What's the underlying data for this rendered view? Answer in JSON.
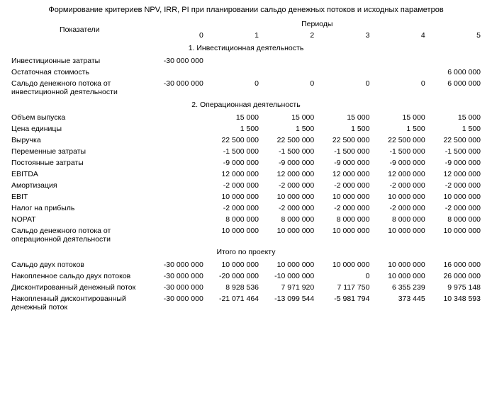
{
  "title": "Формирование критериев NPV, IRR, PI при планировании сальдо денежных потоков и исходных параметров",
  "header": {
    "indicator": "Показатели",
    "periods": "Периоды",
    "cols": [
      "0",
      "1",
      "2",
      "3",
      "4",
      "5"
    ]
  },
  "section1": {
    "heading": "1. Инвестиционная деятельность",
    "rows": [
      {
        "label": "Инвестиционные затраты",
        "v": [
          "-30 000 000",
          "",
          "",
          "",
          "",
          ""
        ]
      },
      {
        "label": "Остаточная стоимость",
        "v": [
          "",
          "",
          "",
          "",
          "",
          "6 000 000"
        ]
      },
      {
        "label": "Сальдо денежного потока от инвестиционной деятельности",
        "v": [
          "-30 000 000",
          "0",
          "0",
          "0",
          "0",
          "6 000 000"
        ]
      }
    ]
  },
  "section2": {
    "heading": "2. Операционная деятельность",
    "rows": [
      {
        "label": "Объем выпуска",
        "v": [
          "",
          "15 000",
          "15 000",
          "15 000",
          "15 000",
          "15 000"
        ]
      },
      {
        "label": "Цена единицы",
        "v": [
          "",
          "1 500",
          "1 500",
          "1 500",
          "1 500",
          "1 500"
        ]
      },
      {
        "label": "Выручка",
        "v": [
          "",
          "22 500 000",
          "22 500 000",
          "22 500 000",
          "22 500 000",
          "22 500 000"
        ]
      },
      {
        "label": "Переменные затраты",
        "v": [
          "",
          "-1 500 000",
          "-1 500 000",
          "-1 500 000",
          "-1 500 000",
          "-1 500 000"
        ]
      },
      {
        "label": "Постоянные затраты",
        "v": [
          "",
          "-9 000 000",
          "-9 000 000",
          "-9 000 000",
          "-9 000 000",
          "-9 000 000"
        ]
      },
      {
        "label": "EBITDA",
        "v": [
          "",
          "12 000 000",
          "12 000 000",
          "12 000 000",
          "12 000 000",
          "12 000 000"
        ]
      },
      {
        "label": "Амортизация",
        "v": [
          "",
          "-2 000 000",
          "-2 000 000",
          "-2 000 000",
          "-2 000 000",
          "-2 000 000"
        ]
      },
      {
        "label": "EBIT",
        "v": [
          "",
          "10 000 000",
          "10 000 000",
          "10 000 000",
          "10 000 000",
          "10 000 000"
        ]
      },
      {
        "label": "Налог на прибыль",
        "v": [
          "",
          "-2 000 000",
          "-2 000 000",
          "-2 000 000",
          "-2 000 000",
          "-2 000 000"
        ]
      },
      {
        "label": "NOPAT",
        "v": [
          "",
          "8 000 000",
          "8 000 000",
          "8 000 000",
          "8 000 000",
          "8 000 000"
        ]
      },
      {
        "label": "Сальдо денежного потока от операционной деятельности",
        "v": [
          "",
          "10 000 000",
          "10 000 000",
          "10 000 000",
          "10 000 000",
          "10 000 000"
        ]
      }
    ]
  },
  "section3": {
    "heading": "Итого по проекту",
    "rows": [
      {
        "label": "Сальдо двух потоков",
        "v": [
          "-30 000 000",
          "10 000 000",
          "10 000 000",
          "10 000 000",
          "10 000 000",
          "16 000 000"
        ]
      },
      {
        "label": "Накопленное сальдо двух потоков",
        "v": [
          "-30 000 000",
          "-20 000 000",
          "-10 000 000",
          "0",
          "10 000 000",
          "26 000 000"
        ]
      },
      {
        "label": "Дисконтированный денежный поток",
        "v": [
          "-30 000 000",
          "8 928 536",
          "7 971 920",
          "7 117 750",
          "6 355 239",
          "9 975 148"
        ]
      },
      {
        "label": "Накопленный дисконтированный денежный поток",
        "v": [
          "-30 000 000",
          "-21 071 464",
          "-13 099 544",
          "-5 981 794",
          "373 445",
          "10 348 593"
        ]
      }
    ]
  }
}
